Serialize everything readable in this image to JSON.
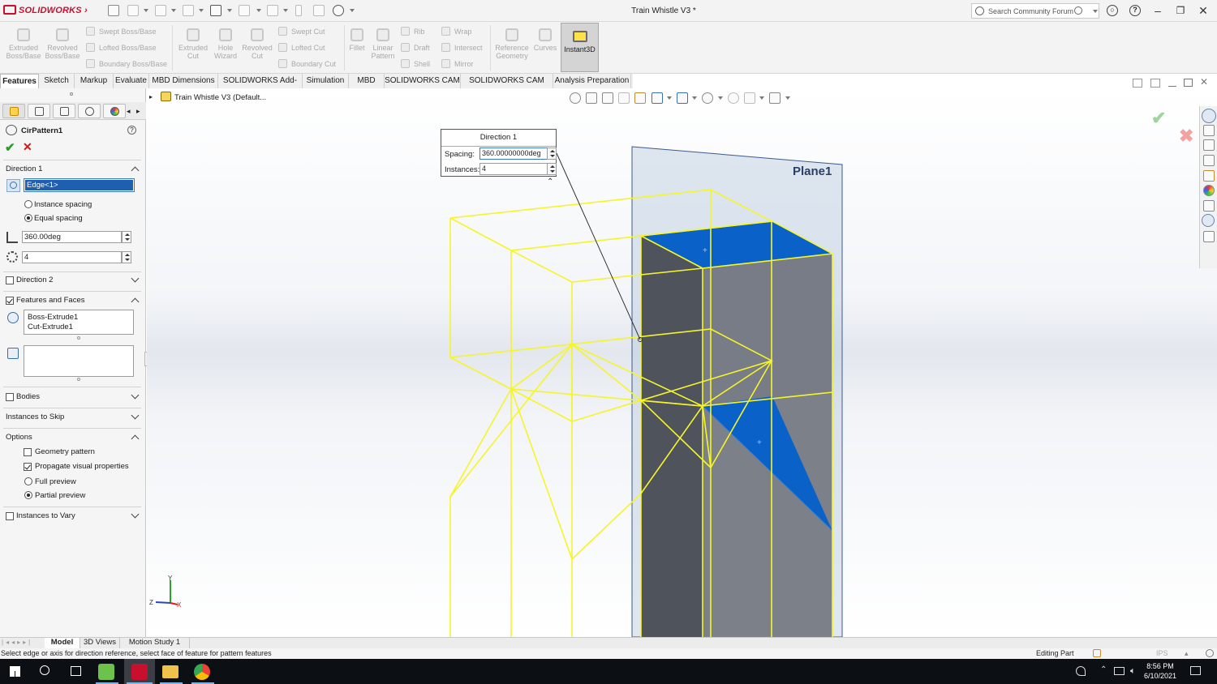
{
  "app": {
    "brand": "SOLIDWORKS",
    "window_title": "Train Whistle V3 *",
    "search_placeholder": "Search Community Forum"
  },
  "ribbon": {
    "big": [
      {
        "id": "extruded-boss",
        "label": "Extruded Boss/Base"
      },
      {
        "id": "revolved-boss",
        "label": "Revolved Boss/Base"
      },
      {
        "id": "extruded-cut",
        "label": "Extruded Cut"
      },
      {
        "id": "hole-wizard",
        "label": "Hole Wizard"
      },
      {
        "id": "revolved-cut",
        "label": "Revolved Cut"
      },
      {
        "id": "fillet",
        "label": "Fillet"
      },
      {
        "id": "linear-pattern",
        "label": "Linear Pattern"
      },
      {
        "id": "reference-geometry",
        "label": "Reference Geometry"
      },
      {
        "id": "curves",
        "label": "Curves"
      }
    ],
    "small": {
      "swept_boss": "Swept Boss/Base",
      "lofted_boss": "Lofted Boss/Base",
      "boundary_boss": "Boundary Boss/Base",
      "swept_cut": "Swept Cut",
      "lofted_cut": "Lofted Cut",
      "boundary_cut": "Boundary Cut",
      "rib": "Rib",
      "draft": "Draft",
      "shell": "Shell",
      "wrap": "Wrap",
      "intersect": "Intersect",
      "mirror": "Mirror"
    },
    "instant3d": "Instant3D"
  },
  "tabs": [
    "Features",
    "Sketch",
    "Markup",
    "Evaluate",
    "MBD Dimensions",
    "SOLIDWORKS Add-Ins",
    "Simulation",
    "MBD",
    "SOLIDWORKS CAM",
    "SOLIDWORKS CAM TBM",
    "Analysis Preparation"
  ],
  "panel": {
    "title": "CirPattern1",
    "direction1": {
      "header": "Direction 1",
      "edge": "Edge<1>",
      "instance_spacing": "Instance spacing",
      "equal_spacing": "Equal spacing",
      "angle": "360.00deg",
      "count": "4"
    },
    "direction2": "Direction 2",
    "features_faces": {
      "header": "Features and Faces",
      "items": [
        "Boss-Extrude1",
        "Cut-Extrude1"
      ]
    },
    "bodies": "Bodies",
    "instances_skip": "Instances to Skip",
    "options": {
      "header": "Options",
      "geometry_pattern": "Geometry pattern",
      "propagate": "Propagate visual properties",
      "full_preview": "Full preview",
      "partial_preview": "Partial preview"
    },
    "instances_vary": "Instances to Vary"
  },
  "viewport": {
    "tree_root": "Train Whistle V3  (Default...",
    "plane_label": "Plane1",
    "popup": {
      "title": "Direction 1",
      "spacing_label": "Spacing:",
      "spacing_value": "360.00000000deg",
      "instances_label": "Instances:",
      "instances_value": "4"
    },
    "triad": {
      "x": "X",
      "y": "Y",
      "z": "Z"
    }
  },
  "bottom_tabs": [
    "Model",
    "3D Views",
    "Motion Study 1"
  ],
  "status": {
    "message": "Select edge or axis for direction reference, select face of feature for pattern features",
    "mode": "Editing Part",
    "units": "IPS"
  },
  "taskbar": {
    "time": "8:56 PM",
    "date": "6/10/2021"
  },
  "colors": {
    "accent": "#1f5fb0",
    "selection": "#f5f52a",
    "face_blue": "#0a62c8",
    "brand_red": "#c8102e"
  }
}
